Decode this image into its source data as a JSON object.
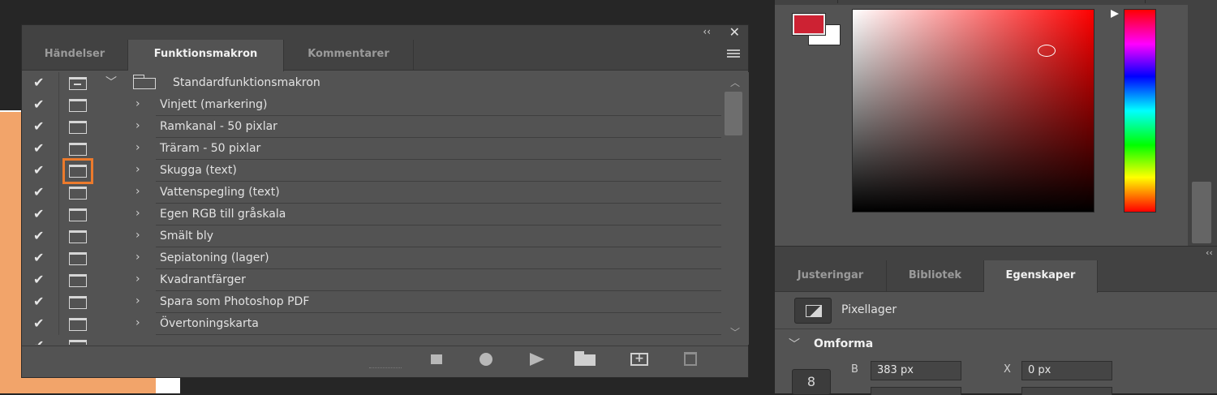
{
  "actions_panel": {
    "collapse_glyph": "‹‹",
    "close_glyph": "✕",
    "tabs": [
      {
        "label": "Händelser",
        "active": false
      },
      {
        "label": "Funktionsmakron",
        "active": true
      },
      {
        "label": "Kommentarer",
        "active": false
      }
    ],
    "set": {
      "name": "Standardfunktionsmakron",
      "checked": true,
      "icon": "folder-icon"
    },
    "actions": [
      {
        "name": "Vinjett (markering)",
        "checked": true
      },
      {
        "name": "Ramkanal - 50 pixlar",
        "checked": true
      },
      {
        "name": "Träram - 50 pixlar",
        "checked": true
      },
      {
        "name": "Skugga (text)",
        "checked": true,
        "dialog_highlighted": true
      },
      {
        "name": "Vattenspegling (text)",
        "checked": true
      },
      {
        "name": "Egen RGB till gråskala",
        "checked": true
      },
      {
        "name": "Smält bly",
        "checked": true
      },
      {
        "name": "Sepiatoning (lager)",
        "checked": true
      },
      {
        "name": "Kvadrantfärger",
        "checked": true
      },
      {
        "name": "Spara som Photoshop PDF",
        "checked": true
      },
      {
        "name": "Övertoningskarta",
        "checked": true
      }
    ],
    "footer_buttons": [
      "stop-icon",
      "record-icon",
      "play-icon",
      "new-set-icon",
      "new-action-icon",
      "trash-icon"
    ],
    "highlight_color": "#ec7a2c"
  },
  "color_panel": {
    "foreground": "#cd2233",
    "background": "#ffffff"
  },
  "properties_panel": {
    "tabs": [
      {
        "label": "Justeringar",
        "active": false
      },
      {
        "label": "Bibliotek",
        "active": false
      },
      {
        "label": "Egenskaper",
        "active": true
      }
    ],
    "layer_type": "Pixellager",
    "section_title": "Omforma",
    "fields": {
      "width_label": "B",
      "width_value": "383 px",
      "x_label": "X",
      "x_value": "0 px"
    },
    "link_glyph": "8"
  }
}
